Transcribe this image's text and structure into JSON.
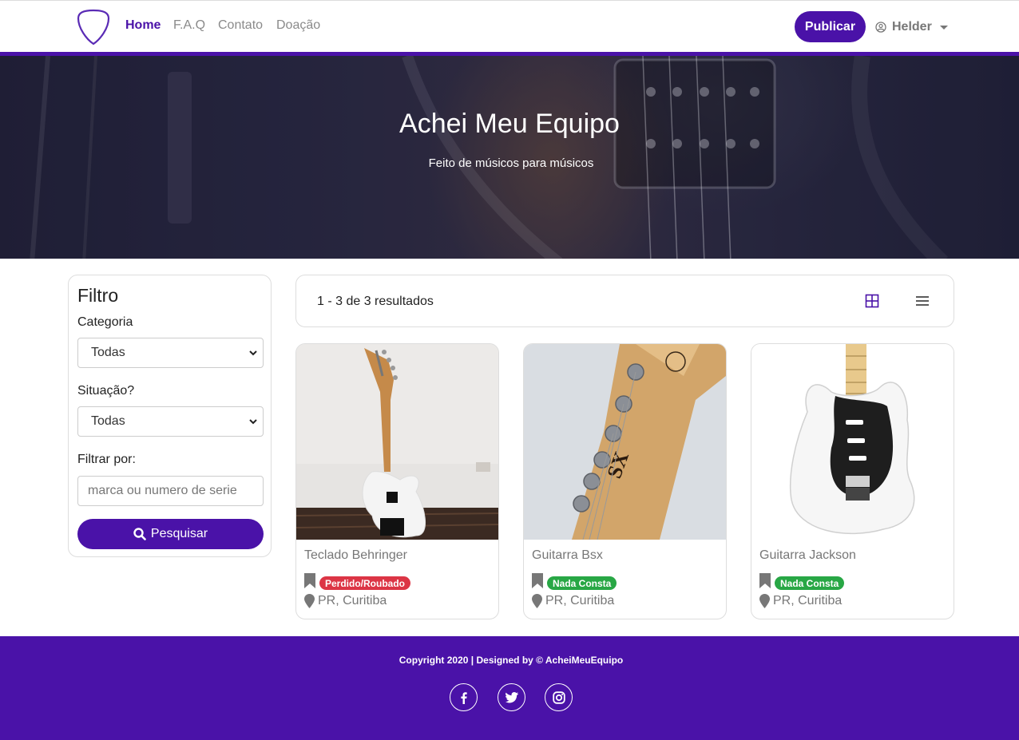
{
  "navbar": {
    "links": [
      "Home",
      "F.A.Q",
      "Contato",
      "Doação"
    ],
    "publish_label": "Publicar",
    "user_name": "Helder"
  },
  "hero": {
    "title": "Achei Meu Equipo",
    "subtitle": "Feito de músicos para músicos"
  },
  "filter": {
    "title": "Filtro",
    "category_label": "Categoria",
    "category_value": "Todas",
    "situation_label": "Situação?",
    "situation_value": "Todas",
    "filter_by_label": "Filtrar por:",
    "search_placeholder": "marca ou numero de serie",
    "search_button": "Pesquisar"
  },
  "results": {
    "summary": "1 - 3 de 3 resultados",
    "view_modes": [
      "grid-icon",
      "list-icon"
    ]
  },
  "cards": [
    {
      "title": "Teclado Behringer",
      "status": "Perdido/Roubado",
      "status_color": "#dc3545",
      "location": "PR, Curitiba"
    },
    {
      "title": "Guitarra Bsx",
      "status": "Nada Consta",
      "status_color": "#28a745",
      "location": "PR, Curitiba"
    },
    {
      "title": "Guitarra Jackson",
      "status": "Nada Consta",
      "status_color": "#28a745",
      "location": "PR, Curitiba"
    }
  ],
  "footer": {
    "copyright": "Copyright 2020 | Designed by © AcheiMeuEquipo",
    "social": [
      "facebook-icon",
      "twitter-icon",
      "instagram-icon"
    ]
  },
  "colors": {
    "brand": "#4a12a8",
    "danger": "#dc3545",
    "success": "#28a745"
  }
}
